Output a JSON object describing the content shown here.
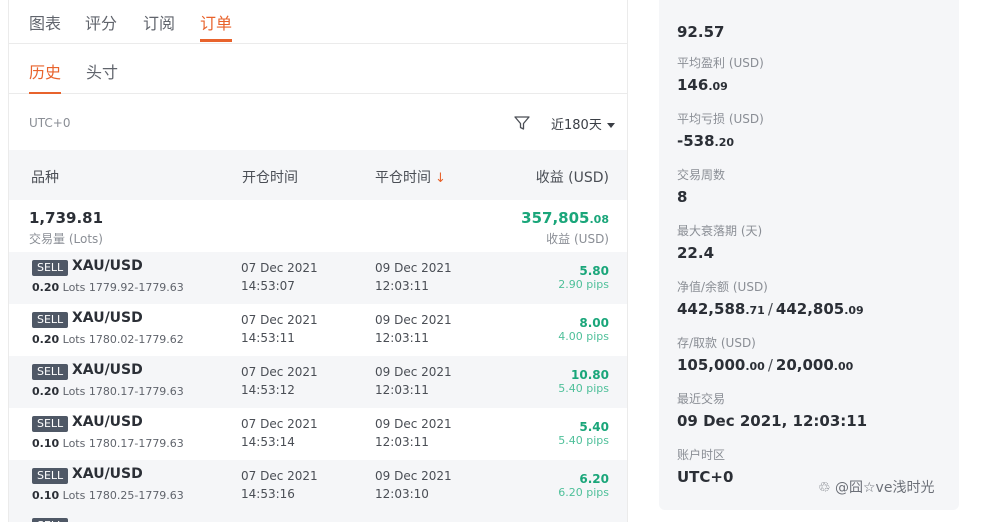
{
  "top_tabs": [
    "图表",
    "评分",
    "订阅",
    "订单"
  ],
  "sub_tabs": [
    "历史",
    "头寸"
  ],
  "filter": {
    "timezone": "UTC+0",
    "range": "近180天"
  },
  "columns": {
    "symbol": "品种",
    "open_time": "开仓时间",
    "close_time": "平仓时间",
    "profit": "收益 (USD)",
    "sort_arrow": "↓"
  },
  "summary": {
    "lots": "1,739.81",
    "lots_label": "交易量 (Lots)",
    "profit_int": "357,805",
    "profit_dec": ".08",
    "profit_label": "收益 (USD)"
  },
  "orders": [
    {
      "side": "SELL",
      "symbol": "XAU/USD",
      "lots": "0.20",
      "lots_unit": "Lots",
      "price": "1779.92-1779.63",
      "open_date": "07 Dec 2021",
      "open_time": "14:53:07",
      "close_date": "09 Dec 2021",
      "close_time": "12:03:11",
      "profit": "5.80",
      "pips": "2.90 pips"
    },
    {
      "side": "SELL",
      "symbol": "XAU/USD",
      "lots": "0.20",
      "lots_unit": "Lots",
      "price": "1780.02-1779.62",
      "open_date": "07 Dec 2021",
      "open_time": "14:53:11",
      "close_date": "09 Dec 2021",
      "close_time": "12:03:11",
      "profit": "8.00",
      "pips": "4.00 pips"
    },
    {
      "side": "SELL",
      "symbol": "XAU/USD",
      "lots": "0.20",
      "lots_unit": "Lots",
      "price": "1780.17-1779.63",
      "open_date": "07 Dec 2021",
      "open_time": "14:53:12",
      "close_date": "09 Dec 2021",
      "close_time": "12:03:11",
      "profit": "10.80",
      "pips": "5.40 pips"
    },
    {
      "side": "SELL",
      "symbol": "XAU/USD",
      "lots": "0.10",
      "lots_unit": "Lots",
      "price": "1780.17-1779.63",
      "open_date": "07 Dec 2021",
      "open_time": "14:53:14",
      "close_date": "09 Dec 2021",
      "close_time": "12:03:11",
      "profit": "5.40",
      "pips": "5.40 pips"
    },
    {
      "side": "SELL",
      "symbol": "XAU/USD",
      "lots": "0.10",
      "lots_unit": "Lots",
      "price": "1780.25-1779.63",
      "open_date": "07 Dec 2021",
      "open_time": "14:53:16",
      "close_date": "09 Dec 2021",
      "close_time": "12:03:10",
      "profit": "6.20",
      "pips": "6.20 pips"
    }
  ],
  "stats": {
    "first_value": "92.57",
    "avg_profit": {
      "label": "平均盈利 (USD)",
      "int": "146",
      "dec": ".09"
    },
    "avg_loss": {
      "label": "平均亏损 (USD)",
      "int": "-538",
      "dec": ".20"
    },
    "weeks": {
      "label": "交易周数",
      "value": "8"
    },
    "max_drawdown_period": {
      "label": "最大衰落期 (天)",
      "value": "22.4"
    },
    "equity_balance": {
      "label": "净值/余额 (USD)",
      "a_int": "442,588",
      "a_dec": ".71",
      "b_int": "442,805",
      "b_dec": ".09",
      "sep": "/"
    },
    "deposit_withdraw": {
      "label": "存/取款 (USD)",
      "a_int": "105,000",
      "a_dec": ".00",
      "b_int": "20,000",
      "b_dec": ".00",
      "sep": "/"
    },
    "last_trade": {
      "label": "最近交易",
      "value": "09 Dec 2021, 12:03:11"
    },
    "account_tz": {
      "label": "账户时区",
      "value": "UTC+0"
    }
  },
  "watermark": "♲ @囧☆ve浅时光",
  "colors": {
    "accent": "#e8632c",
    "profit_green": "#1aa67a",
    "badge_bg": "#4f5866"
  }
}
